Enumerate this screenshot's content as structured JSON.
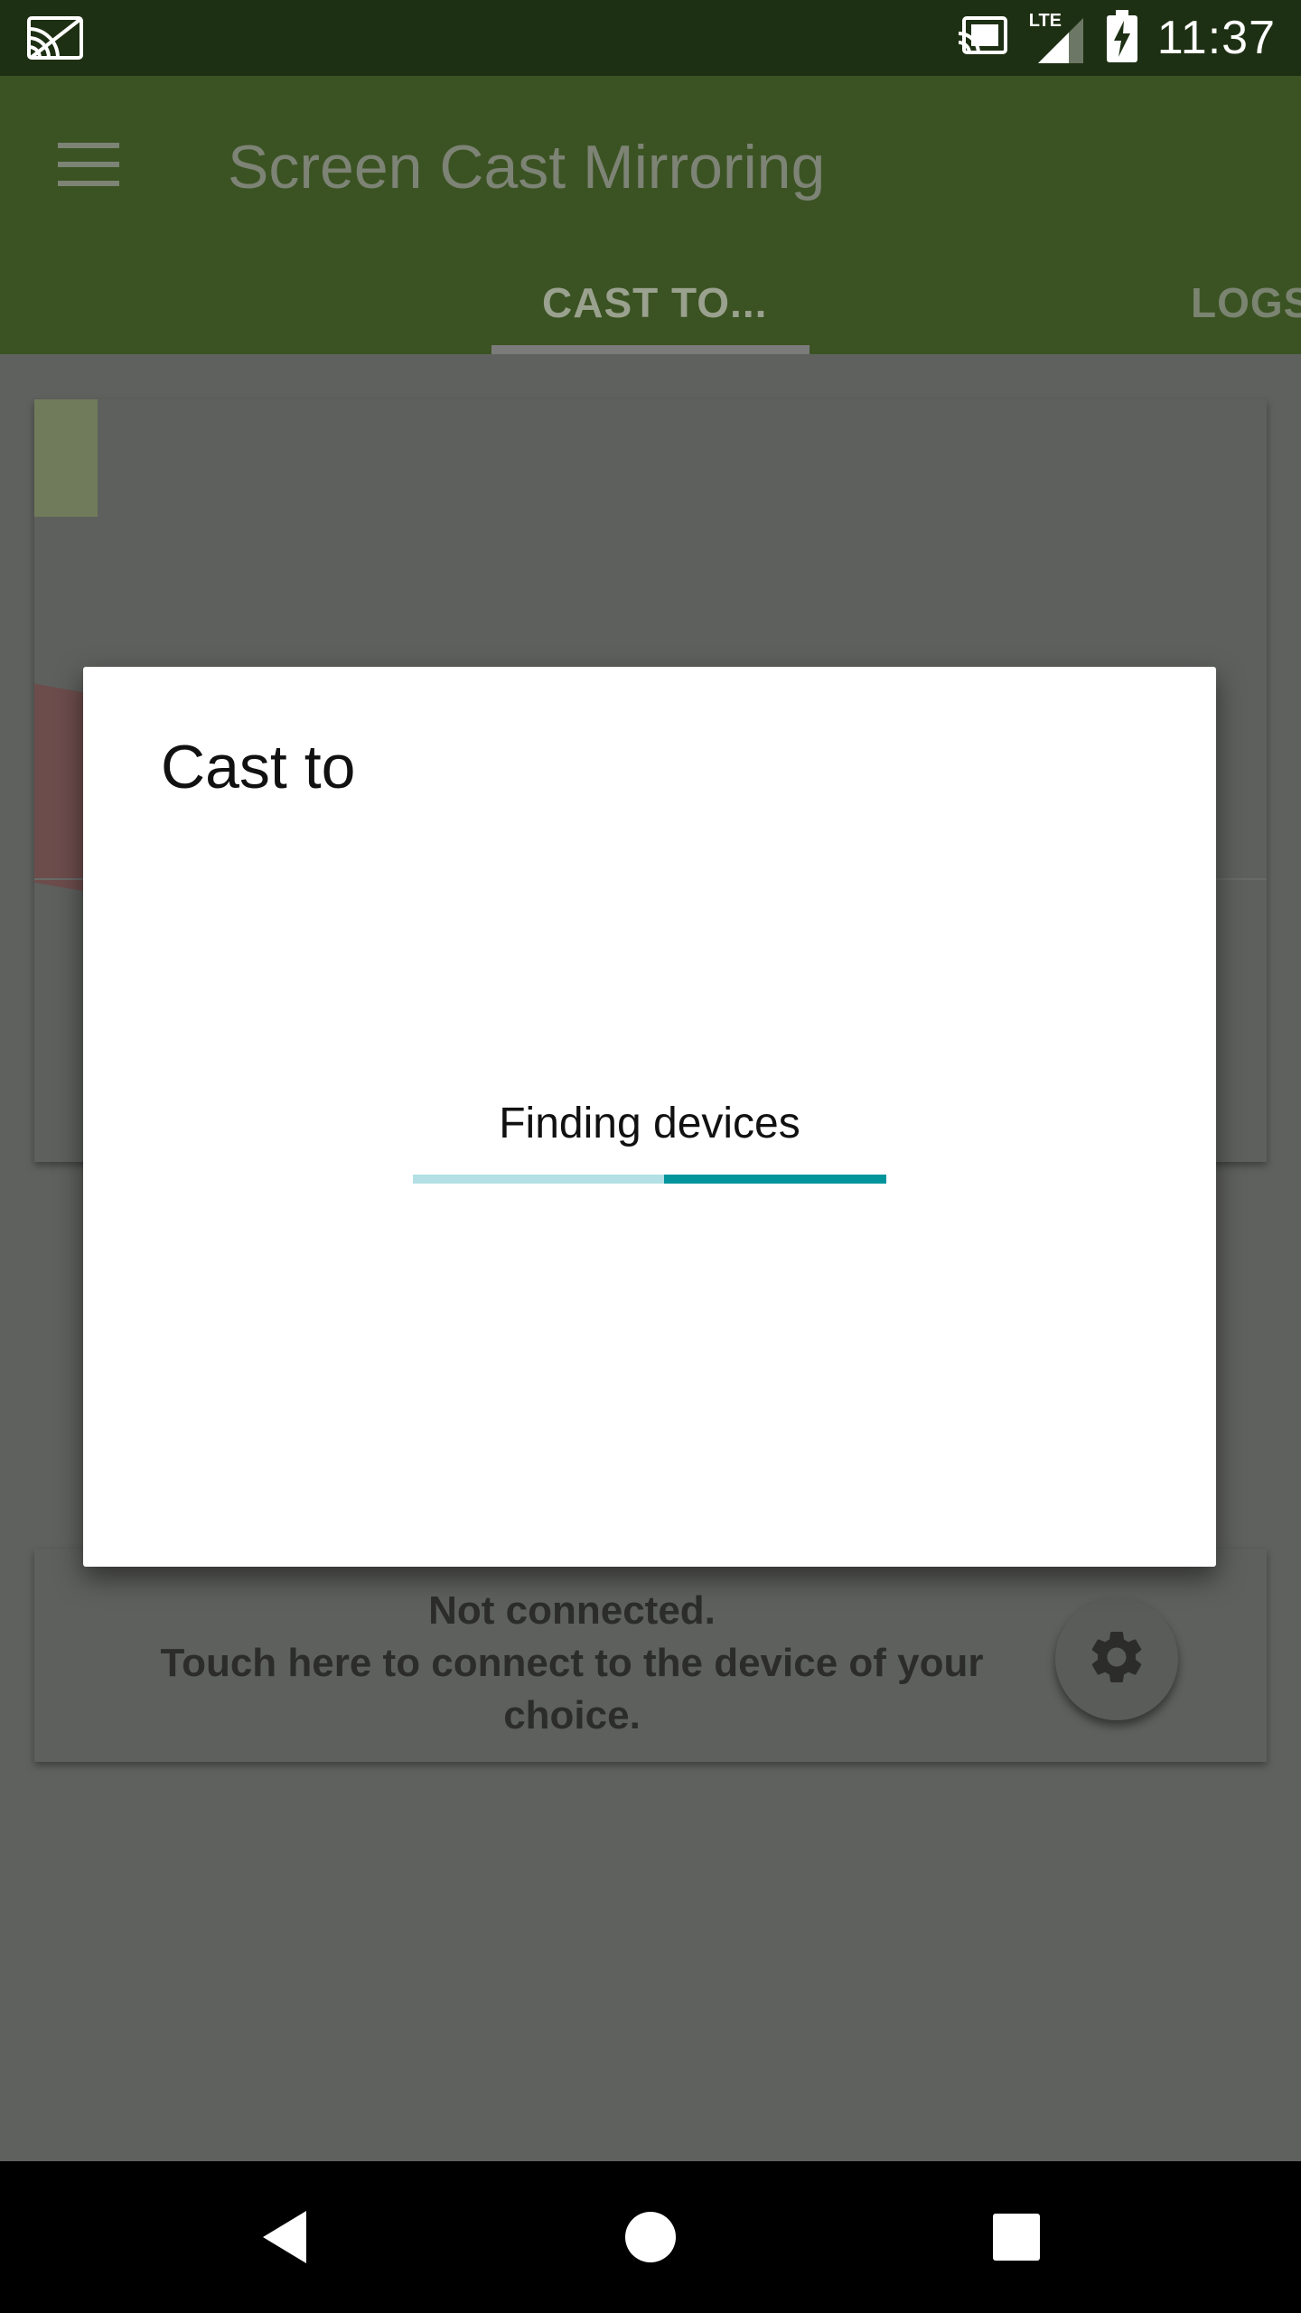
{
  "status_bar": {
    "time": "11:37",
    "network": "LTE",
    "icons": [
      "cast-notification-icon",
      "cast-connected-icon",
      "lte-signal-icon",
      "battery-charging-icon"
    ]
  },
  "app_bar": {
    "title": "Screen Cast Mirroring",
    "menu_icon": "hamburger-menu-icon",
    "tabs": [
      {
        "label": "CAST TO...",
        "selected": true
      },
      {
        "label": "LOGS",
        "selected": false
      }
    ]
  },
  "background_card": {
    "status_text": "Not connected.\nTouch here to connect to the device of your choice.",
    "status_line1": "Not connected.",
    "status_line2": "Touch here to connect to the device of your",
    "status_line3": "choice.",
    "fab_icon": "gear-icon"
  },
  "dialog": {
    "title": "Cast to",
    "status": "Finding devices",
    "progress": {
      "indeterminate": true,
      "filled_fraction_start": 0.53,
      "filled_fraction_end": 1.0
    },
    "colors": {
      "progress_track": "#b3e0e4",
      "progress_fill": "#00959b"
    }
  },
  "nav_bar": {
    "buttons": [
      "back-icon",
      "home-icon",
      "recents-icon"
    ]
  },
  "colors": {
    "status_bar": "#1e3013",
    "app_bar": "#3b5323",
    "scrim_content": "#5f615e"
  }
}
